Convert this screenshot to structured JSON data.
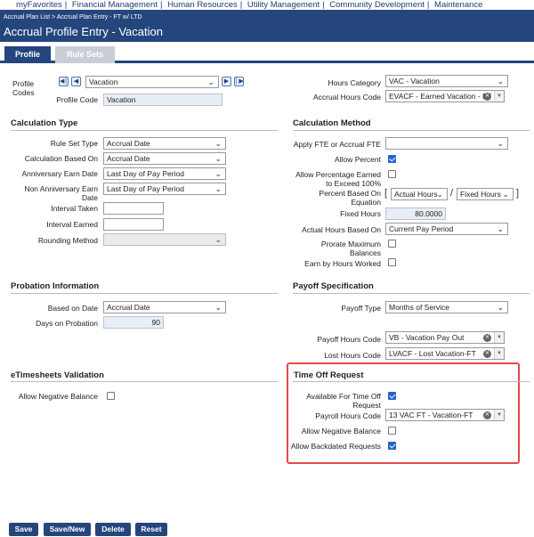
{
  "topnav": [
    "myFavorites",
    "Financial Management",
    "Human Resources",
    "Utility Management",
    "Community Development",
    "Maintenance"
  ],
  "header": {
    "breadcrumb": "Accrual Plan List > Accrual Plan Entry - FT w/ LTD",
    "title": "Accrual Profile Entry - Vacation"
  },
  "tabs": {
    "profile": "Profile",
    "rule_sets": "Rule Sets"
  },
  "profile": {
    "codes_label": "Profile Codes",
    "codes_value": "Vacation",
    "code_label": "Profile Code",
    "code_value": "Vacation",
    "hours_category_label": "Hours Category",
    "hours_category_value": "VAC - Vacation",
    "accrual_hours_code_label": "Accrual Hours Code",
    "accrual_hours_code_value": "EVACF - Earned Vacation - FT"
  },
  "calc_type": {
    "title": "Calculation Type",
    "rule_set_type_label": "Rule Set Type",
    "rule_set_type_value": "Accrual Date",
    "based_on_label": "Calculation Based On",
    "based_on_value": "Accrual Date",
    "anniv_label": "Anniversary Earn Date",
    "anniv_value": "Last Day of Pay Period",
    "non_anniv_label": "Non Anniversary Earn Date",
    "non_anniv_value": "Last Day of Pay Period",
    "interval_taken_label": "Interval Taken",
    "interval_earned_label": "Interval Earned",
    "rounding_label": "Rounding Method"
  },
  "calc_method": {
    "title": "Calculation Method",
    "apply_fte_label": "Apply FTE or Accrual FTE",
    "allow_percent_label": "Allow Percent",
    "allow_pct_earned_label": "Allow Percentage Earned to Exceed 100%",
    "percent_based_label": "Percent Based On Equation",
    "pct_left": "Actual Hours",
    "pct_sep": "/",
    "pct_right": "Fixed Hours",
    "bracket_open": "[",
    "bracket_close": "]",
    "fixed_hours_label": "Fixed Hours",
    "fixed_hours_value": "80.0000",
    "actual_hours_label": "Actual Hours Based On",
    "actual_hours_value": "Current Pay Period",
    "prorate_label": "Prorate Maximum Balances",
    "earn_by_label": "Earn by Hours Worked"
  },
  "probation": {
    "title": "Probation Information",
    "based_on_label": "Based on Date",
    "based_on_value": "Accrual Date",
    "days_label": "Days on Probation",
    "days_value": "90"
  },
  "payoff": {
    "title": "Payoff Specification",
    "type_label": "Payoff Type",
    "type_value": "Months of Service",
    "payoff_code_label": "Payoff Hours Code",
    "payoff_code_value": "VB - Vacation Pay Out",
    "lost_code_label": "Lost Hours Code",
    "lost_code_value": "LVACF - Lost Vacation-FT"
  },
  "etimesheets": {
    "title": "eTimesheets Validation",
    "neg_label": "Allow Negative Balance"
  },
  "time_off": {
    "title": "Time Off Request",
    "available_label": "Available For Time Off Request",
    "payroll_code_label": "Payroll Hours Code",
    "payroll_code_value": "13 VAC FT - Vacation-FT",
    "neg_label": "Allow Negative Balance",
    "backdated_label": "Allow Backdated Requests"
  },
  "buttons": {
    "save": "Save",
    "save_new": "Save/New",
    "delete": "Delete",
    "reset": "Reset"
  },
  "icons": {
    "first": "first-record-icon",
    "prev": "prev-record-icon",
    "next": "next-record-icon",
    "last": "last-record-icon"
  },
  "colors": {
    "brand": "#24467d",
    "highlight": "#e04b4b",
    "check": "#2563c9"
  }
}
